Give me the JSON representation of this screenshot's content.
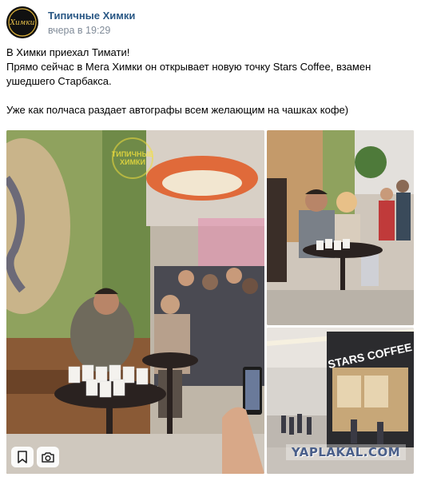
{
  "post": {
    "author": "Типичные Химки",
    "time": "вчера в 19:29",
    "avatar_text": "Химки",
    "text_lines": [
      "В Химки приехал Тимати!",
      "Прямо сейчас в Мега Химки он открывает новую точку Stars Coffee, взамен",
      "ушедшего Старбакса."
    ],
    "text_line_last": "Уже как полчаса раздает автографы всем желающим на чашках кофе)"
  },
  "gallery": {
    "photo_count": 3,
    "store_sign": "STARS COFFEE",
    "watermark_logo_lines": [
      "ТИПИЧНЫЕ",
      "ХИМКИ"
    ],
    "watermark_text": "YAPLAKAL.COM"
  },
  "icons": {
    "bookmark": "bookmark-icon",
    "camera": "camera-icon"
  }
}
